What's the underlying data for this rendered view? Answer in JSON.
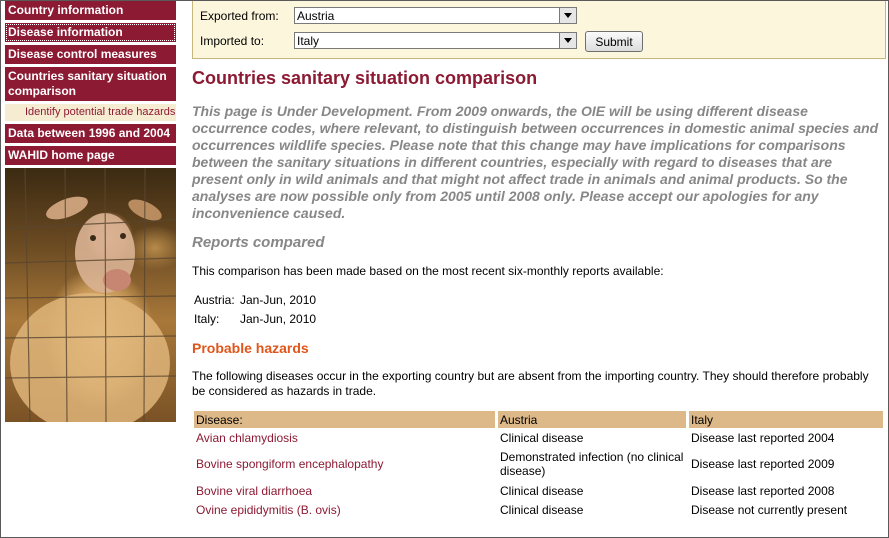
{
  "sidebar": {
    "items": [
      {
        "label": "Country information"
      },
      {
        "label": "Disease information"
      },
      {
        "label": "Disease control measures"
      },
      {
        "label": "Countries sanitary situation comparison"
      },
      {
        "label": "Identify potential trade hazards"
      },
      {
        "label": "Data between 1996 and 2004"
      },
      {
        "label": "WAHID home page"
      }
    ]
  },
  "filter": {
    "exported_label": "Exported from:",
    "exported_value": "Austria",
    "imported_label": "Imported to:",
    "imported_value": "Italy",
    "submit_label": "Submit"
  },
  "main": {
    "title": "Countries sanitary situation comparison",
    "notice": "This page is Under Development. From 2009 onwards, the OIE will be using different disease occurrence codes, where relevant, to distinguish between occurrences in domestic animal species and occurrences wildlife species. Please note that this change may have implications for comparisons between the sanitary situations in different countries, especially with regard to diseases that are present only in wild animals and that might not affect trade in animals and animal products. So the analyses are now possible only from 2005 until 2008 only. Please accept our apologies for any inconvenience caused.",
    "reports_heading": "Reports compared",
    "reports_intro": "This comparison has been made based on the most recent six-monthly reports available:",
    "reports": [
      {
        "country": "Austria:",
        "period": "Jan-Jun, 2010"
      },
      {
        "country": "Italy:",
        "period": "Jan-Jun, 2010"
      }
    ],
    "hazards_heading": "Probable hazards",
    "hazards_intro": "The following diseases occur in the exporting country but are absent from the importing country. They should therefore probably be considered as hazards in trade.",
    "table": {
      "headers": [
        "Disease:",
        "Austria",
        "Italy"
      ],
      "rows": [
        {
          "disease": "Avian chlamydiosis",
          "exporter": "Clinical disease",
          "importer": "Disease last reported 2004"
        },
        {
          "disease": "Bovine spongiform encephalopathy",
          "exporter": "Demonstrated infection (no clinical disease)",
          "importer": "Disease last reported 2009"
        },
        {
          "disease": "Bovine viral diarrhoea",
          "exporter": "Clinical disease",
          "importer": "Disease last reported 2008"
        },
        {
          "disease": "Ovine epididymitis (B. ovis)",
          "exporter": "Clinical disease",
          "importer": "Disease not currently present"
        }
      ]
    }
  },
  "colors": {
    "brand": "#8c1a33",
    "hazard": "#e0561b",
    "header_bg": "#ddb98a",
    "panel_bg": "#fbf6dc",
    "notice": "#878787"
  }
}
